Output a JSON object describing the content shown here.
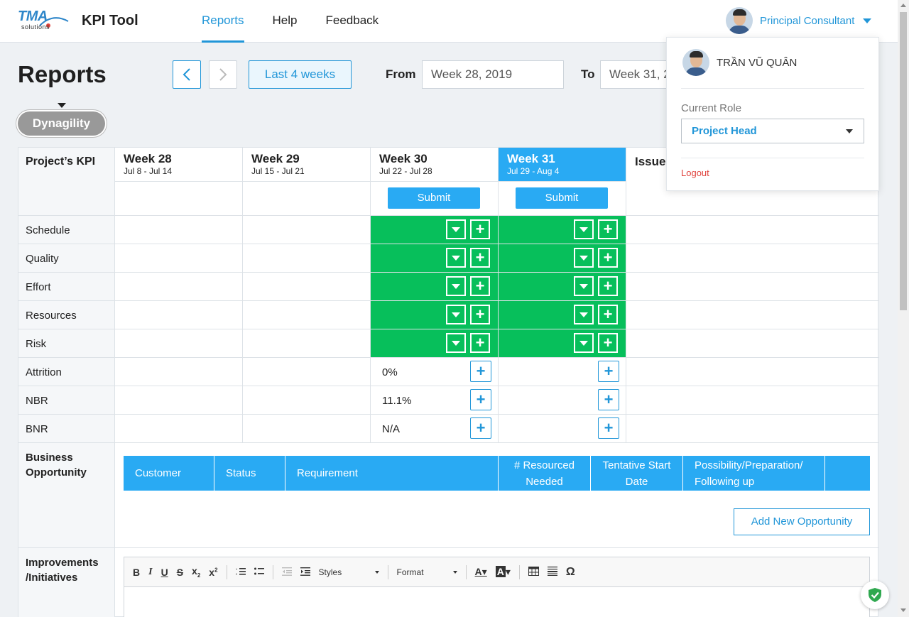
{
  "header": {
    "logo_main": "TMA",
    "logo_sub": "solutions",
    "app_title": "KPI Tool",
    "nav": [
      "Reports",
      "Help",
      "Feedback"
    ],
    "active_nav": "Reports",
    "user_role": "Principal Consultant"
  },
  "page": {
    "title": "Reports",
    "range_button": "Last 4 weeks",
    "from_label": "From",
    "from_value": "Week 28, 2019",
    "to_label": "To",
    "to_value": "Week 31, 2019",
    "project": "Dynagility"
  },
  "grid": {
    "kpi_header": "Project’s KPI",
    "weeks": [
      {
        "title": "Week 28",
        "range": "Jul 8 - Jul 14"
      },
      {
        "title": "Week 29",
        "range": "Jul 15 - Jul 21"
      },
      {
        "title": "Week 30",
        "range": "Jul 22 - Jul 28"
      },
      {
        "title": "Week 31",
        "range": "Jul 29 - Aug 4"
      }
    ],
    "issues_header": "Issue",
    "submit_label": "Submit",
    "rows": [
      "Schedule",
      "Quality",
      "Effort",
      "Resources",
      "Risk",
      "Attrition",
      "NBR",
      "BNR"
    ],
    "week30_values": {
      "Attrition": "0%",
      "NBR": "11.1%",
      "BNR": "N/A"
    },
    "status_color": "#07bf5b",
    "accent_color": "#29aaf3"
  },
  "opportunity": {
    "label": "Business Opportunity",
    "columns": [
      "Customer",
      "Status",
      "Requirement",
      "# Resourced Needed",
      "Tentative Start Date",
      "Possibility/Preparation/ Following up",
      ""
    ],
    "add_button": "Add New Opportunity"
  },
  "improvements": {
    "label": "Improvements /Initiatives",
    "toolbar": {
      "styles": "Styles",
      "format": "Format"
    }
  },
  "dropdown": {
    "name": "TRẦN VŨ QUÂN",
    "role_label": "Current Role",
    "role_value": "Project Head",
    "logout": "Logout"
  }
}
